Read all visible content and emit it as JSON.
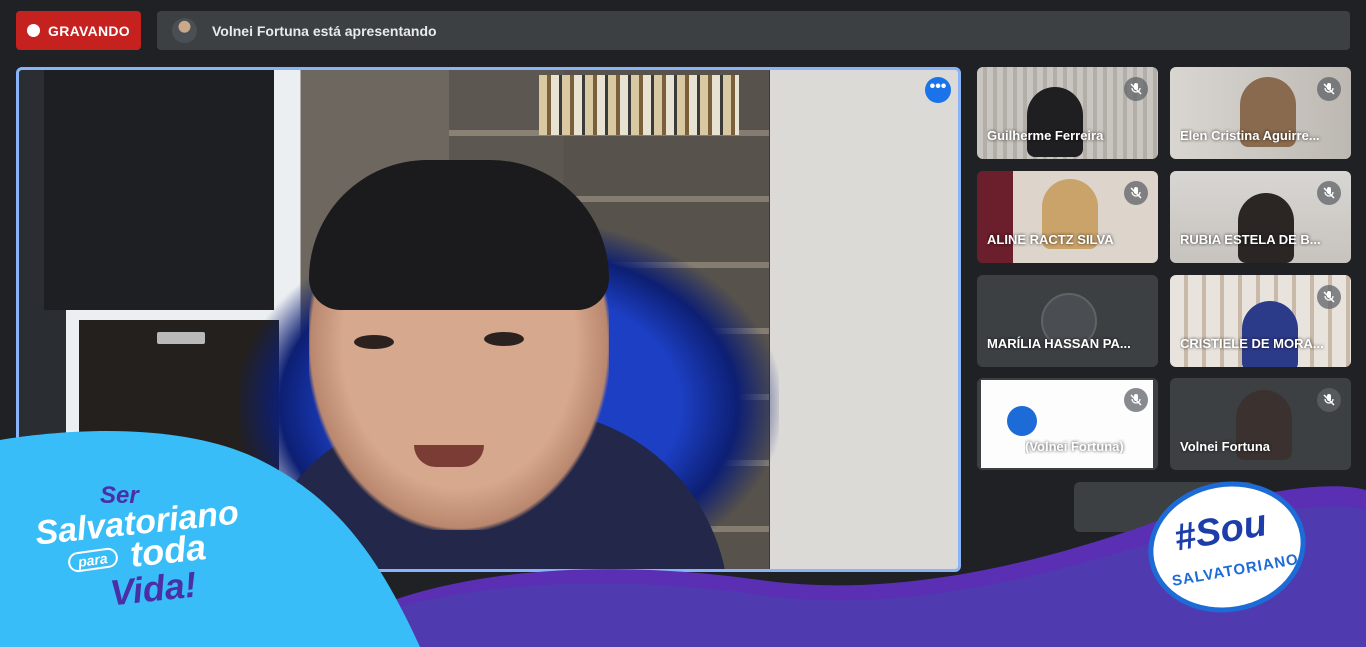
{
  "recording": {
    "label": "GRAVANDO"
  },
  "presenting": {
    "text": "Volnei Fortuna está apresentando"
  },
  "main_video": {
    "more_options_label": "•••"
  },
  "participants": [
    {
      "name": "Guilherme Ferreira",
      "muted": true
    },
    {
      "name": "Elen Cristina Aguirre...",
      "muted": true
    },
    {
      "name": "ALINE RACTZ SILVA",
      "muted": true
    },
    {
      "name": "RUBIA ESTELA DE B...",
      "muted": true
    },
    {
      "name": "MARÍLIA HASSAN PA...",
      "muted": false
    },
    {
      "name": "CRISTIELE DE MORA...",
      "muted": true
    },
    {
      "name": "(Volnei Fortuna)",
      "muted": true,
      "presentation": true
    },
    {
      "name": "Volnei Fortuna",
      "muted": true
    }
  ],
  "branding_left": {
    "line1": "Ser",
    "line2": "Salvatoriano",
    "line3": "para",
    "line4": "toda",
    "line5": "Vida!"
  },
  "branding_right": {
    "line1": "#Sou",
    "line2": "SALVATORIANO"
  },
  "colors": {
    "record_red": "#c5221f",
    "active_border": "#8ab4f8",
    "overlay_cyan": "#38bdf8",
    "overlay_purple": "#5b2fb4"
  }
}
